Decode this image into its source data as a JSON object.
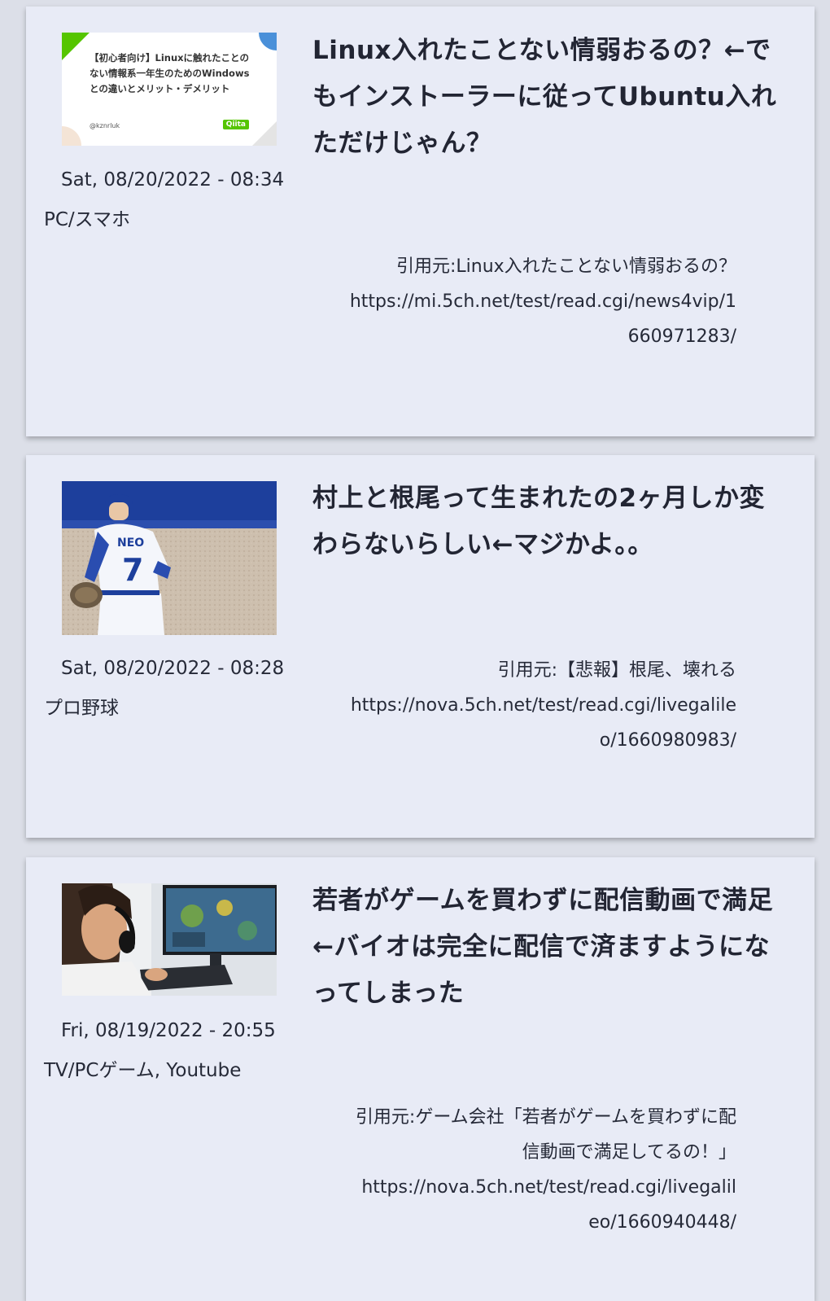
{
  "colors": {
    "page_bg": "#dcdfe8",
    "card_bg": "#e8ebf6",
    "text": "#222533"
  },
  "articles": [
    {
      "title": "Linux入れたことない情弱おるの？←でもインストーラーに従ってUbuntu入れただけじゃん？",
      "date": "Sat, 08/20/2022 - 08:34",
      "category": "PC/スマホ",
      "source_label": "引用元:Linux入れたことない情弱おるの？",
      "source_url": "https://mi.5ch.net/test/read.cgi/news4vip/1660971283/",
      "thumb": {
        "text": "【初心者向け】Linuxに触れたことのない情報系一年生のためのWindowsとの違いとメリット・デメリット",
        "author": "@kznrluk",
        "logo": "Qiita"
      }
    },
    {
      "title": "村上と根尾って生まれたの2ヶ月しか変わらないらしい←マジかよ。。",
      "date": "Sat, 08/20/2022 - 08:28",
      "category": "プロ野球",
      "source_label": "引用元:【悲報】根尾、壊れる",
      "source_url": "https://nova.5ch.net/test/read.cgi/livegalileo/1660980983/",
      "thumb": {
        "jersey_name": "NEO",
        "jersey_number": "7"
      }
    },
    {
      "title": "若者がゲームを買わずに配信動画で満足←バイオは完全に配信で済ますようになってしまった",
      "date": "Fri, 08/19/2022 - 20:55",
      "category": "TV/PCゲーム, Youtube",
      "source_label": "引用元:ゲーム会社「若者がゲームを買わずに配信動画で満足してるの！」",
      "source_url": "https://nova.5ch.net/test/read.cgi/livegalileo/1660940448/"
    }
  ]
}
